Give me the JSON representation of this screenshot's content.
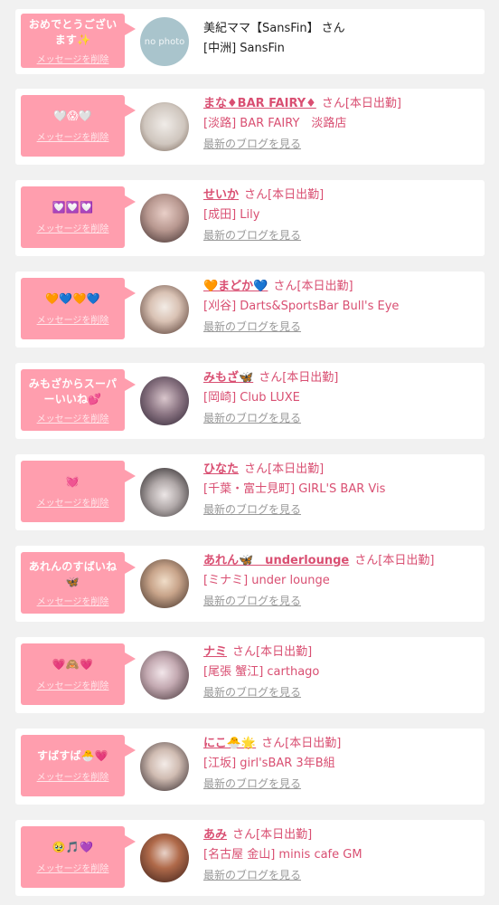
{
  "delete_label": "メッセージを削除",
  "blog_label": "最新のブログを見る",
  "no_photo_label": "no photo",
  "colors": {
    "accent": "#d94f72",
    "bubble": "#ff9eae"
  },
  "items": [
    {
      "message": "おめでとうございます✨",
      "name": "美紀ママ【SansFin】",
      "suffix": "さん",
      "shop": "[中洲] SansFin"
    },
    {
      "message": "🤍😱🤍",
      "name": "まな♦BAR FAIRY♦",
      "suffix": "さん[本日出勤]",
      "shop": "[淡路] BAR FAIRY　淡路店"
    },
    {
      "message": "💟💟💟",
      "name": "せいか",
      "suffix": "さん[本日出勤]",
      "shop": "[成田] Lily"
    },
    {
      "message": "🧡💙🧡💙",
      "name": "🧡まどか💙",
      "suffix": "さん[本日出勤]",
      "shop": "[刈谷] Darts&SportsBar Bull's Eye"
    },
    {
      "message": "みもざからスーパーいいね💕",
      "name": "みもざ🦋",
      "suffix": "さん[本日出勤]",
      "shop": "[岡崎] Club LUXE"
    },
    {
      "message": "💓",
      "name": "ひなた",
      "suffix": "さん[本日出勤]",
      "shop": "[千葉・富士見町] GIRL'S BAR Vis"
    },
    {
      "message": "あれんのすばいね🦋",
      "name": "あれん🦋　underlounge",
      "suffix": "さん[本日出勤]",
      "shop": "[ミナミ] under lounge"
    },
    {
      "message": "💗🙈💗",
      "name": "ナミ",
      "suffix": "さん[本日出勤]",
      "shop": "[尾張 蟹江] carthago"
    },
    {
      "message": "すばすば🐣💗",
      "name": "にこ🐣🌟",
      "suffix": "さん[本日出勤]",
      "shop": "[江坂] girl'sBAR 3年B組"
    },
    {
      "message": "🥹🎵💜",
      "name": "あみ",
      "suffix": "さん[本日出勤]",
      "shop": "[名古屋 金山] minis cafe GM"
    }
  ]
}
